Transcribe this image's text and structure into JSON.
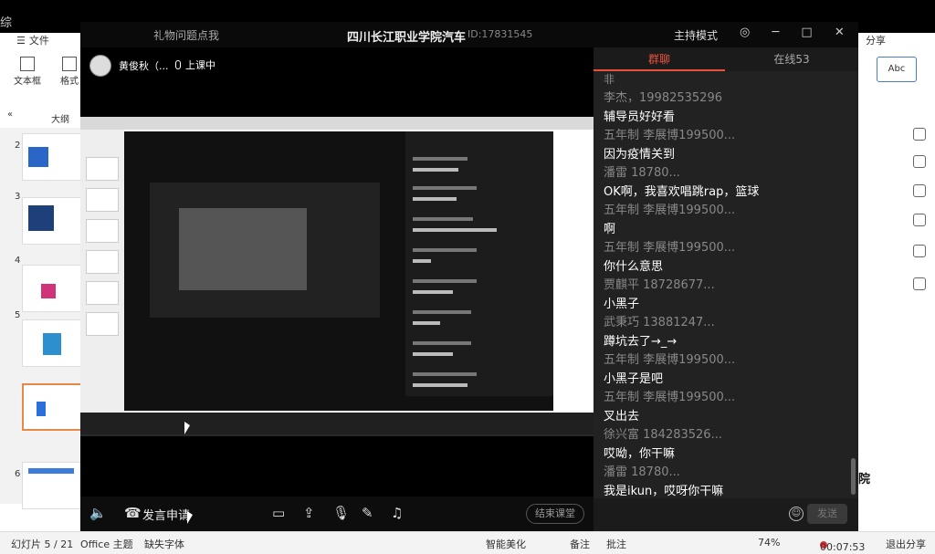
{
  "office": {
    "top_left_char": "综",
    "file_menu": "文件",
    "toolbar": [
      "文本框",
      "格式"
    ],
    "outline_tabs": [
      "大纲"
    ],
    "slide_numbers": [
      "2",
      "3",
      "4",
      "5",
      "6"
    ],
    "right_share": "分享",
    "right_abc": "Abc",
    "right_text": "院",
    "status": {
      "slide": "幻灯片 5 / 21",
      "theme": "Office 主题",
      "font": "缺失字体",
      "beautify": "智能美化",
      "notes": "备注",
      "comment": "批注",
      "zoom": "74%",
      "timer": "00:07:53",
      "exit_share": "退出分享"
    }
  },
  "classroom": {
    "left_title": "礼物问题点我",
    "title": "四川长江职业学院汽车",
    "id": "ID:17831545",
    "host_mode": "主持模式",
    "teacher_name": "黄俊秋（...",
    "status": "上课中",
    "bottom": {
      "speak_request": "发言申请",
      "end_class": "结束课堂"
    }
  },
  "chat": {
    "tab_chat": "群聊",
    "tab_online": "在线53",
    "first_char": "非",
    "messages": [
      {
        "name": "李杰，19982535296",
        "text": "辅导员好好看"
      },
      {
        "name": "五年制  李展博199500...",
        "text": "因为疫情关到"
      },
      {
        "name": "潘雷        18780...",
        "text": "OK啊，我喜欢唱跳rap，篮球"
      },
      {
        "name": "五年制  李展博199500...",
        "text": "啊"
      },
      {
        "name": "五年制  李展博199500...",
        "text": "你什么意思"
      },
      {
        "name": "贾麒平   18728677...",
        "text": "小黑子"
      },
      {
        "name": "武秉巧   13881247...",
        "text": "蹲坑去了→_→"
      },
      {
        "name": "五年制  李展博199500...",
        "text": "小黑子是吧"
      },
      {
        "name": "五年制  李展博199500...",
        "text": "叉出去"
      },
      {
        "name": "徐兴富   184283526...",
        "text": "哎呦，你干嘛"
      },
      {
        "name": "潘雷        18780...",
        "text": "我是ikun，哎呀你干嘛"
      }
    ],
    "send": "发送"
  }
}
